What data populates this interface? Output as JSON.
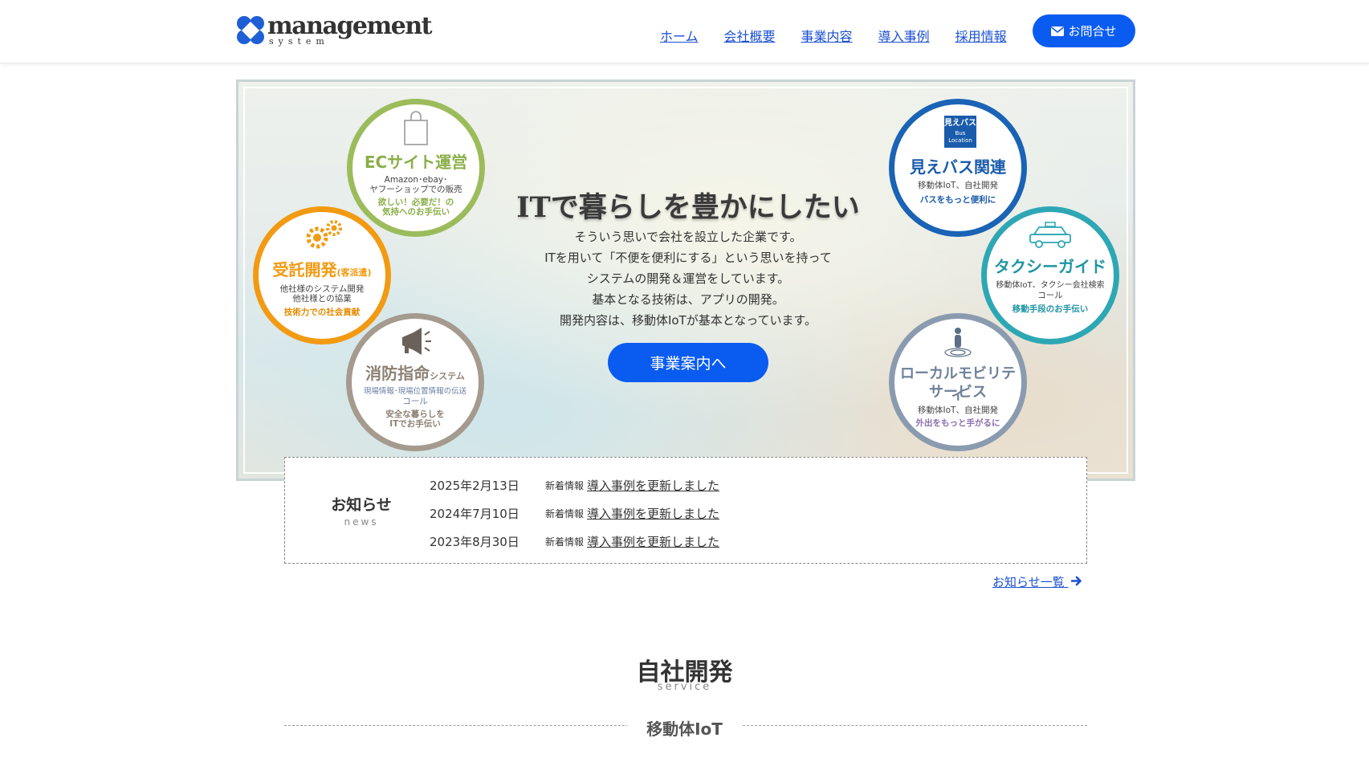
{
  "header": {
    "logo_word": "management",
    "logo_sub": "system",
    "nav": [
      "ホーム",
      "会社概要",
      "事業内容",
      "導入事例",
      "採用情報"
    ],
    "contact_label": "お問合せ"
  },
  "hero": {
    "title": "ITで暮らしを豊かにしたい",
    "lines": [
      "そういう思いで会社を設立した企業です。",
      "ITを用いて「不便を便利にする」という思いを持って",
      "システムの開発＆運営をしています。",
      "基本となる技術は、アプリの開発。",
      "開発内容は、移動体IoTが基本となっています。"
    ],
    "button_label": "事業案内へ",
    "circles": {
      "ec": {
        "title": "ECサイト運営",
        "desc1": "Amazon･ebay･",
        "desc2": "ヤフーショップでの販売",
        "tag1": "欲しい！必要だ！の",
        "tag2": "気持へのお手伝い",
        "color": "#9cbc5c"
      },
      "contract": {
        "title": "受託開発",
        "title_small": "(客派遣)",
        "desc1": "他社様のシステム開発",
        "desc2": "他社様との協業",
        "tag1": "技術力での社会貢献",
        "color": "#f29a12"
      },
      "fire": {
        "title": "消防指命",
        "title_small": "システム",
        "desc1": "現場情報･現場位置情報の伝送",
        "desc2": "コール",
        "tag1": "安全な暮らしを",
        "tag2": "ITでお手伝い",
        "color": "#a59a8e"
      },
      "bus": {
        "badge1": "見えバス",
        "badge2": "Bus",
        "badge3": "Location",
        "title": "見えバス関連",
        "desc1": "移動体IoT、自社開発",
        "tag1": "バスをもっと便利に",
        "color": "#1a63b5"
      },
      "taxi": {
        "title": "タクシーガイド",
        "desc1": "移動体IoT、タクシー会社検索",
        "desc2": "コール",
        "tag1": "移動手段のお手伝い",
        "color": "#2ea7b5"
      },
      "local": {
        "title1": "ローカルモビリティ",
        "title2": "サービス",
        "desc1": "移動体IoT、自社開発",
        "tag1": "外出をもっと手がるに",
        "color": "#8a9bb0"
      }
    }
  },
  "news": {
    "heading": "お知らせ",
    "heading_en": "news",
    "items": [
      {
        "date": "2025年2月13日",
        "category": "新着情報",
        "title": "導入事例を更新しました"
      },
      {
        "date": "2024年7月10日",
        "category": "新着情報",
        "title": "導入事例を更新しました"
      },
      {
        "date": "2023年8月30日",
        "category": "新着情報",
        "title": "導入事例を更新しました"
      }
    ],
    "more_label": "お知らせ一覧"
  },
  "service": {
    "title": "自社開発",
    "subtitle": "service",
    "first_box_label": "移動体IoT"
  },
  "colors": {
    "accent": "#0a5bf0",
    "link": "#1a4fd0"
  }
}
